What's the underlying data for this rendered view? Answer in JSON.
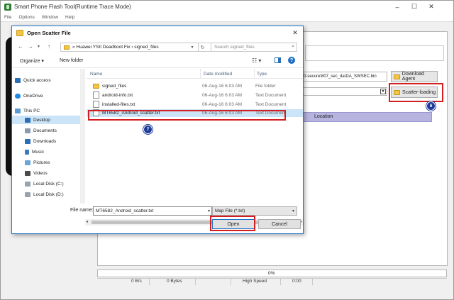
{
  "app": {
    "title": "Smart Phone Flash Tool(Runtime Trace Mode)",
    "minimize": "–",
    "maximize": "☐",
    "close": "✕",
    "menu": [
      "File",
      "Options",
      "Window",
      "Help"
    ],
    "da_path": "0-secure\\807_sec_da\\DA_SWSEC.bin",
    "scatter_path": "",
    "download_agent_label": "Download Agent",
    "scatter_loading_label": "Scatter-loading",
    "step6": "6",
    "table_location_header": "Location",
    "progress_percent": "0%",
    "status": {
      "speed": "0 B/s",
      "bytes": "0 Bytes",
      "mode": "High Speed",
      "time": "0:00"
    }
  },
  "dialog": {
    "title": "Open Scatter File",
    "close": "✕",
    "address_path": "« Huawei YSII Deadboot Fix  ›  signed_files",
    "search_placeholder": "Search signed_files",
    "organize_label": "Organize ▾",
    "new_folder_label": "New folder",
    "nav": {
      "quick_access": "Quick access",
      "onedrive": "OneDrive",
      "this_pc": "This PC",
      "desktop": "Desktop",
      "documents": "Documents",
      "downloads": "Downloads",
      "music": "Music",
      "pictures": "Pictures",
      "videos": "Videos",
      "local_c": "Local Disk (C:)",
      "local_d": "Local Disk (D:)"
    },
    "columns": {
      "name": "Name",
      "date": "Date modified",
      "type": "Type"
    },
    "files": [
      {
        "name": "signed_files",
        "date": "06-Aug-16 6:03 AM",
        "type": "File folder"
      },
      {
        "name": "android-info.txt",
        "date": "06-Aug-16 6:03 AM",
        "type": "Text Document"
      },
      {
        "name": "installed-files.txt",
        "date": "06-Aug-16 6:03 AM",
        "type": "Text Document"
      },
      {
        "name": "MT6582_Android_scatter.txt",
        "date": "06-Aug-16 6:03 AM",
        "type": "Text Document"
      }
    ],
    "step7": "7",
    "filename_label": "File name:",
    "filename_value": "MT6582_Android_scatter.txt",
    "filetype_value": "Map File (*.txt)",
    "open_label": "Open",
    "cancel_label": "Cancel"
  },
  "colors": {
    "highlight_red": "#d21f1f",
    "badge_blue": "#1f3b9a",
    "selection_blue": "#cce4f7",
    "table_header": "#b8b4e0"
  }
}
